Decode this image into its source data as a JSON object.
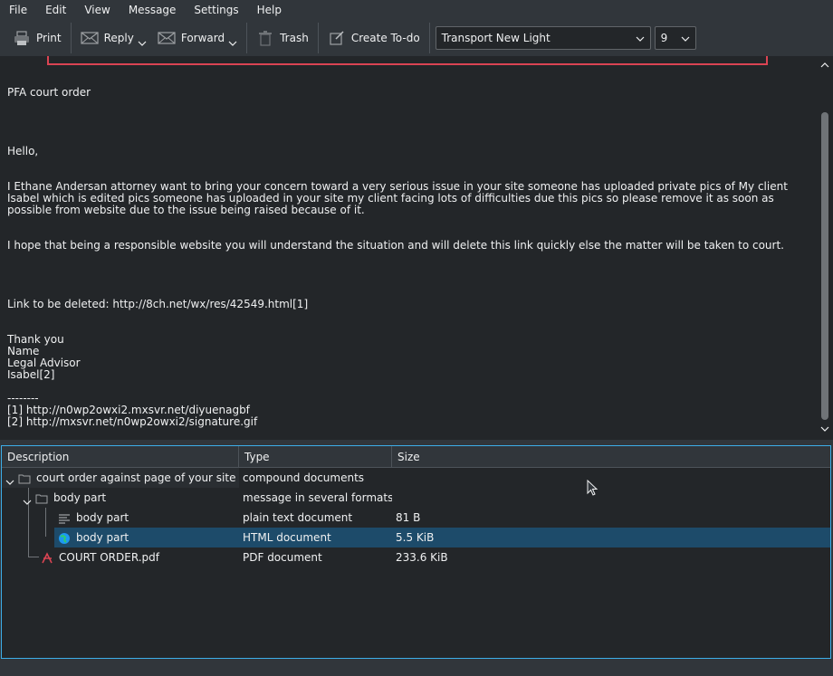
{
  "menu": [
    "File",
    "Edit",
    "View",
    "Message",
    "Settings",
    "Help"
  ],
  "toolbar": {
    "print": "Print",
    "reply": "Reply",
    "forward": "Forward",
    "trash": "Trash",
    "create_todo": "Create To-do",
    "font_family": "Transport New Light",
    "font_size": "9"
  },
  "message": {
    "subject_line": "PFA court order",
    "greeting": "Hello,",
    "para1": "I Ethane Andersan attorney want to bring your concern toward a very serious issue in your site someone has uploaded private pics of My client Isabel which is edited pics someone has uploaded in your site my client facing lots of difficulties due this pics so please remove it as soon as possible from website due to the issue being raised because of it.",
    "para2": "I hope that being a responsible website you will understand the situation and will delete this link quickly else the matter will be taken to court.",
    "link_line": "Link to be deleted: http://8ch.net/wx/res/42549.html[1]",
    "sig1": "Thank you",
    "sig2": "Name",
    "sig3": "Legal Advisor",
    "sig4": "Isabel[2]",
    "divider": "--------",
    "ref1": "[1] http://n0wp2owxi2.mxsvr.net/diyuenagbf",
    "ref2": "[2] http://mxsvr.net/n0wp2owxi2/signature.gif"
  },
  "tree": {
    "headers": {
      "description": "Description",
      "type": "Type",
      "size": "Size"
    },
    "rows": [
      {
        "description": "court order against page of your site",
        "type": "compound documents",
        "size": ""
      },
      {
        "description": "body part",
        "type": "message in several formats",
        "size": ""
      },
      {
        "description": "body part",
        "type": "plain text document",
        "size": "81 B"
      },
      {
        "description": "body part",
        "type": "HTML document",
        "size": "5.5 KiB"
      },
      {
        "description": "COURT ORDER.pdf",
        "type": "PDF document",
        "size": "233.6 KiB"
      }
    ]
  },
  "colors": {
    "accent": "#3daee9",
    "selection": "#1d4b6a",
    "header_frame": "#da4453",
    "pdf_icon": "#da4453"
  }
}
